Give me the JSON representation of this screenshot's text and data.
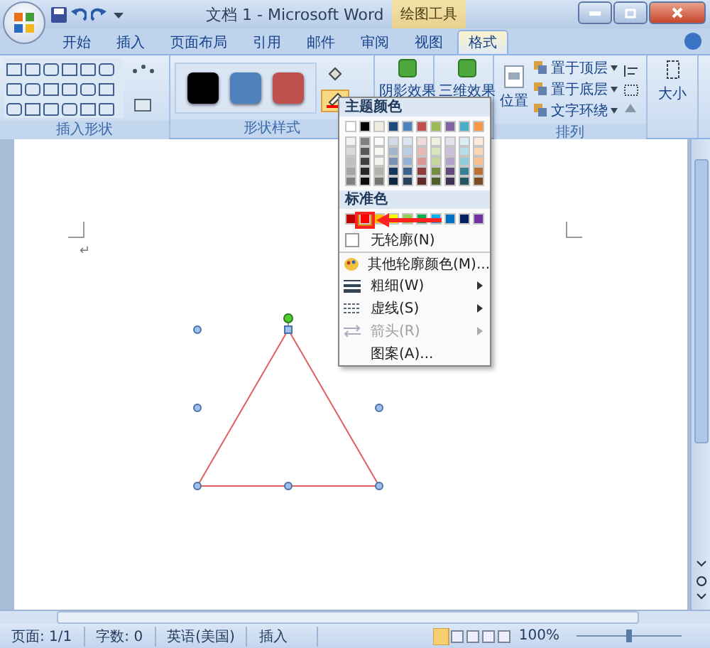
{
  "window": {
    "title": "文档 1 - Microsoft Word",
    "context_tab": "绘图工具"
  },
  "tabs": [
    {
      "label": "开始",
      "selected": false
    },
    {
      "label": "插入",
      "selected": false
    },
    {
      "label": "页面布局",
      "selected": false
    },
    {
      "label": "引用",
      "selected": false
    },
    {
      "label": "邮件",
      "selected": false
    },
    {
      "label": "审阅",
      "selected": false
    },
    {
      "label": "视图",
      "selected": false
    },
    {
      "label": "格式",
      "selected": true
    }
  ],
  "shapes_group": {
    "label": "插入形状"
  },
  "styles_group": {
    "label": "形状样式",
    "swatches": [
      {
        "color": "#000000"
      },
      {
        "color": "#4f81bd"
      },
      {
        "color": "#c0504d"
      }
    ]
  },
  "effects": [
    {
      "label": "阴影效果"
    },
    {
      "label": "三维效果"
    }
  ],
  "arrange_group": {
    "label": "排列",
    "position": "位置",
    "commands": [
      "置于顶层",
      "置于底层",
      "文字环绕"
    ]
  },
  "size_button": "大小",
  "outline_menu": {
    "theme_header": "主题颜色",
    "theme_colors": [
      {
        "color": "#ffffff"
      },
      {
        "color": "#000000"
      },
      {
        "color": "#eeece1"
      },
      {
        "color": "#1f497d"
      },
      {
        "color": "#4f81bd"
      },
      {
        "color": "#c0504d"
      },
      {
        "color": "#9bbb59"
      },
      {
        "color": "#8064a2"
      },
      {
        "color": "#4bacc6"
      },
      {
        "color": "#f79646"
      }
    ],
    "standard_header": "标准色",
    "standard_colors": [
      {
        "color": "#c00000",
        "selected": false
      },
      {
        "color": "#ff0000",
        "selected": true
      },
      {
        "color": "#ffc000",
        "selected": false
      },
      {
        "color": "#ffff00",
        "selected": false
      },
      {
        "color": "#92d050",
        "selected": false
      },
      {
        "color": "#00b050",
        "selected": false
      },
      {
        "color": "#00b0f0",
        "selected": false
      },
      {
        "color": "#0070c0",
        "selected": false
      },
      {
        "color": "#002060",
        "selected": false
      },
      {
        "color": "#7030a0",
        "selected": false
      }
    ],
    "items": [
      {
        "label": "无轮廓(N)",
        "kind": "none",
        "submenu": false,
        "disabled": false
      },
      {
        "label": "其他轮廓颜色(M)...",
        "kind": "palette",
        "submenu": false,
        "disabled": false
      },
      {
        "label": "粗细(W)",
        "kind": "weight",
        "submenu": true,
        "disabled": false
      },
      {
        "label": "虚线(S)",
        "kind": "dash",
        "submenu": true,
        "disabled": false
      },
      {
        "label": "箭头(R)",
        "kind": "arrow",
        "submenu": true,
        "disabled": true
      },
      {
        "label": "图案(A)...",
        "kind": "pattern",
        "submenu": false,
        "disabled": false
      }
    ]
  },
  "document": {
    "paragraph_mark": "↵"
  },
  "status_bar": {
    "fields": [
      "页面: 1/1",
      "字数: 0",
      "英语(美国)",
      "插入"
    ],
    "zoom": "100%",
    "zoom_level": {
      "level": 0.5
    }
  }
}
